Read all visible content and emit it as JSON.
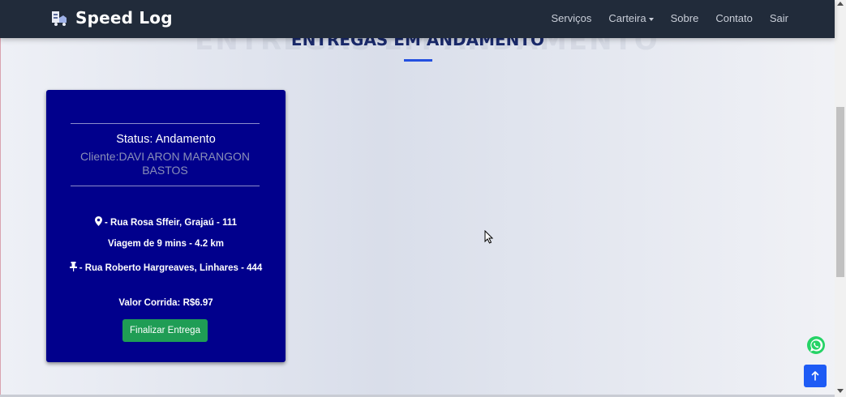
{
  "navbar": {
    "brand": "Speed Log",
    "links": [
      "Serviços",
      "Carteira",
      "Sobre",
      "Contato",
      "Sair"
    ]
  },
  "section": {
    "title": "ENTREGAS EM ANDAMENTO"
  },
  "delivery_card": {
    "status": "Status: Andamento",
    "client": "Cliente:DAVI ARON MARANGON BASTOS",
    "origin": "- Rua Rosa Sffeir, Grajaú - 111",
    "trip": "Viagem de 9 mins - 4.2 km",
    "destination": "- Rua Roberto Hargreaves, Linhares - 444",
    "fare": "Valor Corrida: R$6.97",
    "finish_button": "Finalizar Entrega"
  },
  "icons": {
    "brand": "logistics-logo-icon",
    "origin": "map-marker-icon",
    "destination": "pushpin-icon",
    "whatsapp": "whatsapp-icon",
    "back_to_top": "arrow-up-icon"
  },
  "colors": {
    "navbar": "#212b3a",
    "card": "#01008c",
    "accent": "#2450e0",
    "button": "#1f9d55",
    "whatsapp": "#25d366",
    "back_to_top": "#1e5bf5"
  }
}
